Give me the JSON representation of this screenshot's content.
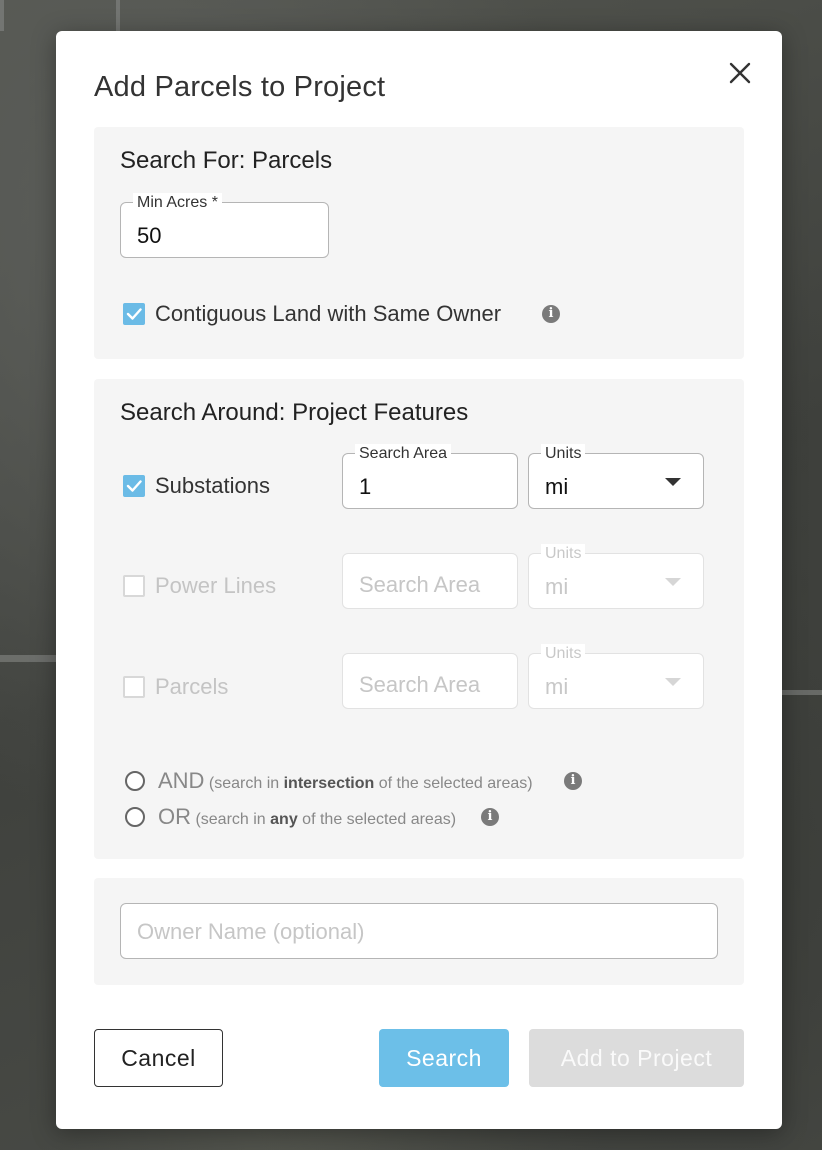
{
  "dialog": {
    "title": "Add Parcels to Project",
    "close_icon": "close-icon"
  },
  "search_for": {
    "title": "Search For: Parcels",
    "min_acres": {
      "label": "Min Acres *",
      "value": "50"
    },
    "contiguous": {
      "label": "Contiguous Land with Same Owner",
      "checked": true,
      "icon": "info-icon"
    }
  },
  "search_around": {
    "title": "Search Around: Project Features",
    "features": [
      {
        "label": "Substations",
        "checked": true,
        "enabled": true,
        "area_label": "Search Area",
        "area_value": "1",
        "units_label": "Units",
        "units_value": "mi"
      },
      {
        "label": "Power Lines",
        "checked": false,
        "enabled": false,
        "area_placeholder": "Search Area",
        "units_label": "Units",
        "units_value": "mi"
      },
      {
        "label": "Parcels",
        "checked": false,
        "enabled": false,
        "area_placeholder": "Search Area",
        "units_label": "Units",
        "units_value": "mi"
      }
    ],
    "logic": [
      {
        "keyword": "AND",
        "pre": "(search in ",
        "bold": "intersection",
        "post": " of the selected areas)",
        "selected": false
      },
      {
        "keyword": "OR",
        "pre": "(search in ",
        "bold": "any",
        "post": " of the selected areas)",
        "selected": false
      }
    ]
  },
  "owner": {
    "placeholder": "Owner Name (optional)",
    "value": ""
  },
  "actions": {
    "cancel": "Cancel",
    "search": "Search",
    "add": "Add to Project"
  },
  "colors": {
    "accent": "#6cbfe8",
    "checkbox": "#6bbbe6",
    "disabled_button": "#dcdcdc",
    "section_bg": "#f5f5f5"
  }
}
